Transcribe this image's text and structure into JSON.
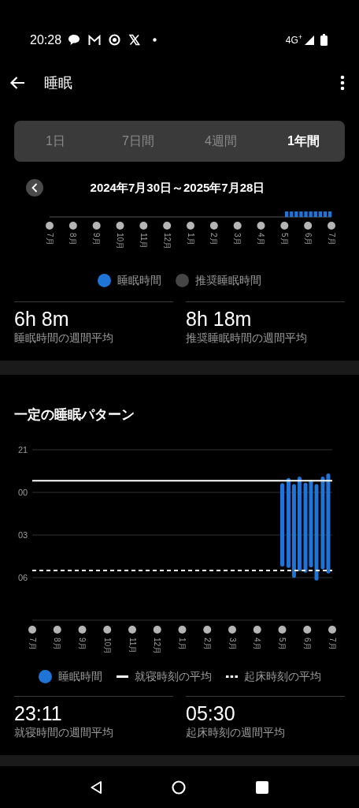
{
  "status_bar": {
    "time": "20:28",
    "network": "4G$^{+}$"
  },
  "app_bar": {
    "title": "睡眠"
  },
  "tabs": [
    {
      "label": "1日",
      "selected": false
    },
    {
      "label": "7日間",
      "selected": false
    },
    {
      "label": "4週間",
      "selected": false
    },
    {
      "label": "1年間",
      "selected": true
    }
  ],
  "date_range": "2024年7月30日～2025年7月28日",
  "duration_chart": {
    "months": [
      "7月",
      "8月",
      "9月",
      "10月",
      "11月",
      "12月",
      "1月",
      "2月",
      "3月",
      "4月",
      "5月",
      "6月",
      "7月"
    ]
  },
  "duration_legend": [
    {
      "label": "睡眠時間",
      "color": "#1f74d8"
    },
    {
      "label": "推奨睡眠時間",
      "color": "#454545"
    }
  ],
  "duration_stats": [
    {
      "value": "6h 8m",
      "label": "睡眠時間の週間平均"
    },
    {
      "value": "8h 18m",
      "label": "推奨睡眠時間の週間平均"
    }
  ],
  "pattern": {
    "title": "一定の睡眠パターン",
    "chart": {
      "hour_labels": [
        "21",
        "00",
        "03",
        "06"
      ],
      "months": [
        "7月",
        "8月",
        "9月",
        "10月",
        "11月",
        "12月",
        "1月",
        "2月",
        "3月",
        "4月",
        "5月",
        "6月",
        "7月"
      ]
    },
    "legend": [
      {
        "kind": "dot",
        "label": "睡眠時間",
        "color": "#1f74d8"
      },
      {
        "kind": "solid",
        "label": "就寝時刻の平均"
      },
      {
        "kind": "dashed",
        "label": "起床時刻の平均"
      }
    ]
  },
  "pattern_stats": [
    {
      "value": "23:11",
      "label": "就寝時間の週間平均"
    },
    {
      "value": "05:30",
      "label": "起床時刻の週間平均"
    }
  ]
}
